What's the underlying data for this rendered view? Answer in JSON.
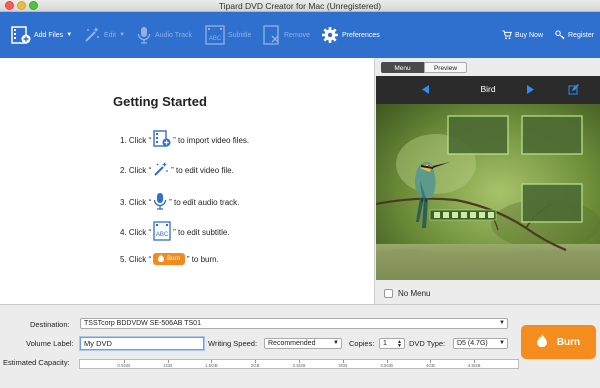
{
  "window": {
    "title": "Tipard DVD Creator for Mac (Unregistered)"
  },
  "toolbar": {
    "add_files": "Add Files",
    "edit": "Edit",
    "audio_track": "Audio Track",
    "subtitle": "Subtitle",
    "remove": "Remove",
    "preferences": "Preferences",
    "buy_now": "Buy Now",
    "register": "Register"
  },
  "getting_started": {
    "title": "Getting Started",
    "steps": [
      {
        "prefix": "1. Click “",
        "suffix": "” to import video files.",
        "icon": "add-video-icon"
      },
      {
        "prefix": "2. Click “",
        "suffix": "” to edit video file.",
        "icon": "magic-wand-icon"
      },
      {
        "prefix": "3. Click “",
        "suffix": "” to edit audio track.",
        "icon": "microphone-icon"
      },
      {
        "prefix": "4. Click “",
        "suffix": "” to edit subtitle.",
        "icon": "subtitle-icon"
      },
      {
        "prefix": "5. Click “",
        "suffix": "” to burn.",
        "icon": "burn-icon",
        "button_label": "Burn"
      }
    ]
  },
  "preview": {
    "tabs": [
      "Menu",
      "Preview"
    ],
    "active_tab": "Menu",
    "menu_title": "Bird",
    "no_menu_label": "No Menu",
    "no_menu_checked": false
  },
  "bottom": {
    "destination_label": "Destination:",
    "destination_value": "TSSTcorp BDDVDW SE-506AB TS01",
    "volume_label": "Volume Label:",
    "volume_value": "My DVD",
    "writing_speed_label": "Writing Speed:",
    "writing_speed_value": "Recommended",
    "copies_label": "Copies:",
    "copies_value": "1",
    "dvd_type_label": "DVD Type:",
    "dvd_type_value": "D5 (4.7G)",
    "estimated_capacity_label": "Estimated Capacity:",
    "capacity_ticks": [
      "0.5GB",
      "1GB",
      "1.5GB",
      "2GB",
      "2.5GB",
      "3GB",
      "3.5GB",
      "4GB",
      "4.5GB"
    ],
    "burn_label": "Burn"
  },
  "colors": {
    "toolbar": "#2f6fce",
    "burn": "#f58d1e"
  }
}
